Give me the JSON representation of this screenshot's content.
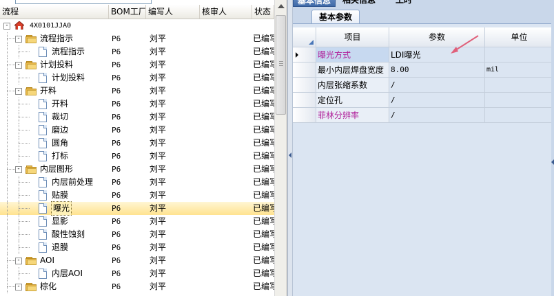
{
  "tree": {
    "headers": {
      "flow": "流程",
      "bom": "BOM工厂",
      "writer": "编写人",
      "reviewer": "核审人",
      "status": "状态"
    },
    "rows": [
      {
        "label": "4X0101JJA0",
        "type": "root",
        "level": 0,
        "bom": "",
        "writer": "",
        "reviewer": "",
        "status": ""
      },
      {
        "label": "流程指示",
        "type": "folder",
        "level": 1,
        "bom": "P6",
        "writer": "刘平",
        "reviewer": "",
        "status": "已编写"
      },
      {
        "label": "流程指示",
        "type": "doc",
        "level": 2,
        "bom": "P6",
        "writer": "刘平",
        "reviewer": "",
        "status": "已编写"
      },
      {
        "label": "计划投料",
        "type": "folder",
        "level": 1,
        "bom": "P6",
        "writer": "刘平",
        "reviewer": "",
        "status": "已编写"
      },
      {
        "label": "计划投料",
        "type": "doc",
        "level": 2,
        "bom": "P6",
        "writer": "刘平",
        "reviewer": "",
        "status": "已编写"
      },
      {
        "label": "开料",
        "type": "folder",
        "level": 1,
        "bom": "P6",
        "writer": "刘平",
        "reviewer": "",
        "status": "已编写"
      },
      {
        "label": "开料",
        "type": "doc",
        "level": 2,
        "bom": "P6",
        "writer": "刘平",
        "reviewer": "",
        "status": "已编写"
      },
      {
        "label": "裁切",
        "type": "doc",
        "level": 2,
        "bom": "P6",
        "writer": "刘平",
        "reviewer": "",
        "status": "已编写"
      },
      {
        "label": "磨边",
        "type": "doc",
        "level": 2,
        "bom": "P6",
        "writer": "刘平",
        "reviewer": "",
        "status": "已编写"
      },
      {
        "label": "圆角",
        "type": "doc",
        "level": 2,
        "bom": "P6",
        "writer": "刘平",
        "reviewer": "",
        "status": "已编写"
      },
      {
        "label": "打标",
        "type": "doc",
        "level": 2,
        "bom": "P6",
        "writer": "刘平",
        "reviewer": "",
        "status": "已编写"
      },
      {
        "label": "内层图形",
        "type": "folder",
        "level": 1,
        "bom": "P6",
        "writer": "刘平",
        "reviewer": "",
        "status": "已编写"
      },
      {
        "label": "内层前处理",
        "type": "doc",
        "level": 2,
        "bom": "P6",
        "writer": "刘平",
        "reviewer": "",
        "status": "已编写"
      },
      {
        "label": "贴膜",
        "type": "doc",
        "level": 2,
        "bom": "P6",
        "writer": "刘平",
        "reviewer": "",
        "status": "已编写"
      },
      {
        "label": "曝光",
        "type": "doc",
        "level": 2,
        "bom": "P6",
        "writer": "刘平",
        "reviewer": "",
        "status": "已编写",
        "selected": true
      },
      {
        "label": "显影",
        "type": "doc",
        "level": 2,
        "bom": "P6",
        "writer": "刘平",
        "reviewer": "",
        "status": "已编写"
      },
      {
        "label": "酸性蚀刻",
        "type": "doc",
        "level": 2,
        "bom": "P6",
        "writer": "刘平",
        "reviewer": "",
        "status": "已编写"
      },
      {
        "label": "退膜",
        "type": "doc",
        "level": 2,
        "bom": "P6",
        "writer": "刘平",
        "reviewer": "",
        "status": "已编写"
      },
      {
        "label": "AOI",
        "type": "folder",
        "level": 1,
        "bom": "P6",
        "writer": "刘平",
        "reviewer": "",
        "status": "已编写"
      },
      {
        "label": "内层AOI",
        "type": "doc",
        "level": 2,
        "bom": "P6",
        "writer": "刘平",
        "reviewer": "",
        "status": "已编写"
      },
      {
        "label": "棕化",
        "type": "folder",
        "level": 1,
        "bom": "P6",
        "writer": "刘平",
        "reviewer": "",
        "status": "已编写"
      }
    ]
  },
  "right": {
    "top_tabs": [
      "基本信息",
      "相关信息",
      "工时"
    ],
    "subtab": "基本参数",
    "grid_headers": {
      "item": "项目",
      "param": "参数",
      "unit": "单位"
    },
    "grid_rows": [
      {
        "item": "曝光方式",
        "param": "LDI曝光",
        "unit": "",
        "magenta": true,
        "current": true
      },
      {
        "item": "最小内层焊盘宽度",
        "param": "8.00",
        "unit": "mil",
        "magenta": false
      },
      {
        "item": "内层张缩系数",
        "param": "/",
        "unit": "",
        "magenta": false
      },
      {
        "item": "定位孔",
        "param": "/",
        "unit": "",
        "magenta": false
      },
      {
        "item": "菲林分辨率",
        "param": "/",
        "unit": "",
        "magenta": true
      }
    ]
  },
  "colors": {
    "magenta_text": "#b0209a",
    "selection": "#ffe38f",
    "accent": "#3f6aa8",
    "arrow": "#e0607a"
  }
}
